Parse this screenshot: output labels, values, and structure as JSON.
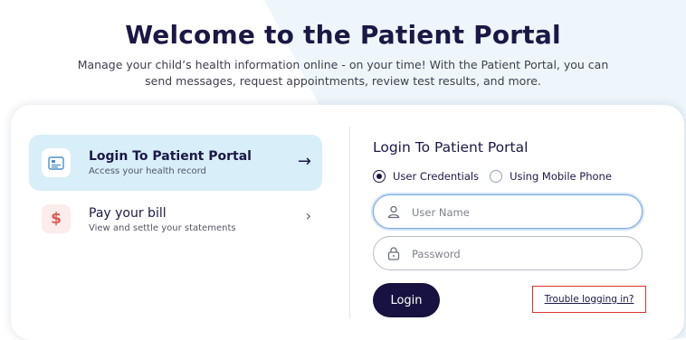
{
  "hero": {
    "title": "Welcome to the Patient Portal",
    "description": "Manage your child’s health information online - on your time! With the Patient Portal, you can send messages, request appointments, review test results, and more."
  },
  "menu": {
    "items": [
      {
        "title": "Login To Patient Portal",
        "subtitle": "Access your health record",
        "icon": "id-card-icon",
        "arrow": "→",
        "active": true
      },
      {
        "title": "Pay your bill",
        "subtitle": "View and settle your statements",
        "icon": "dollar-icon",
        "icon_glyph": "$",
        "arrow": "›",
        "active": false
      }
    ]
  },
  "login_form": {
    "title": "Login To Patient Portal",
    "radio_options": [
      {
        "label": "User Credentials",
        "checked": true
      },
      {
        "label": "Using Mobile Phone",
        "checked": false
      }
    ],
    "username": {
      "value": "",
      "placeholder": "User Name",
      "icon": "user-icon"
    },
    "password": {
      "value": "",
      "placeholder": "Password",
      "icon": "lock-icon"
    },
    "login_label": "Login",
    "trouble_label": "Trouble logging in?"
  },
  "colors": {
    "primary": "#17123f",
    "active_bg": "#d8eef8",
    "highlight_border": "#d9362b",
    "bill_icon": "#e05a4f"
  }
}
